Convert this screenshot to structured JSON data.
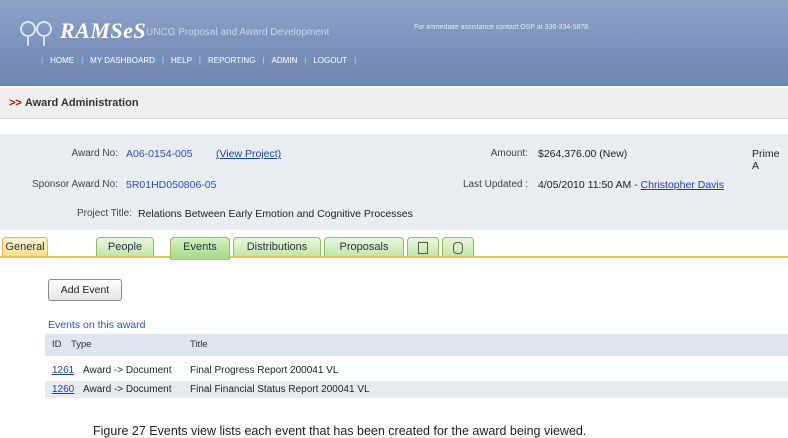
{
  "header": {
    "brand": "RAMSeS",
    "subtitle": "UNCG Proposal and Award Development",
    "assistance": "For immediate assistance contact OSP at 336-334-5878",
    "nav": [
      "HOME",
      "MY DASHBOARD",
      "HELP",
      "REPORTING",
      "ADMIN",
      "LOGOUT"
    ]
  },
  "breadcrumb": {
    "arrows": ">>",
    "title": "Award Administration"
  },
  "award": {
    "award_no_label": "Award No:",
    "award_no": "A06-0154-005",
    "view_project": "(View Project)",
    "amount_label": "Amount:",
    "amount": "$264,376.00 (New)",
    "prime_label": "Prime A",
    "sponsor_label": "Sponsor Award No:",
    "sponsor_no": "5R01HD050806-05",
    "updated_label": "Last Updated :",
    "updated_value": "4/05/2010 11:50 AM - ",
    "updated_by": "Christopher Davis",
    "title_label": "Project Title:",
    "title": "Relations Between Early Emotion and Cognitive Processes"
  },
  "tabs": [
    "General",
    "People",
    "Events",
    "Distributions",
    "Proposals"
  ],
  "tab_icons": [
    "document-icon",
    "attachment-icon"
  ],
  "add_event_label": "Add Event",
  "events_heading": "Events on this award",
  "columns": {
    "id": "ID",
    "type": "Type",
    "title": "Title"
  },
  "events": [
    {
      "id": "1261",
      "type": "Award -> Document",
      "title": "Final Progress Report 200041 VL"
    },
    {
      "id": "1260",
      "type": "Award -> Document",
      "title": "Final Financial Status Report 200041 VL"
    }
  ],
  "caption": "Figure 27 Events view lists each event that has been created for the award being viewed.",
  "colors": {
    "header": "#7990bb",
    "link": "#1a3fb5",
    "accent_red": "#cc0000",
    "tab_green": "#a6d880",
    "tab_active": "#fbe08a"
  }
}
